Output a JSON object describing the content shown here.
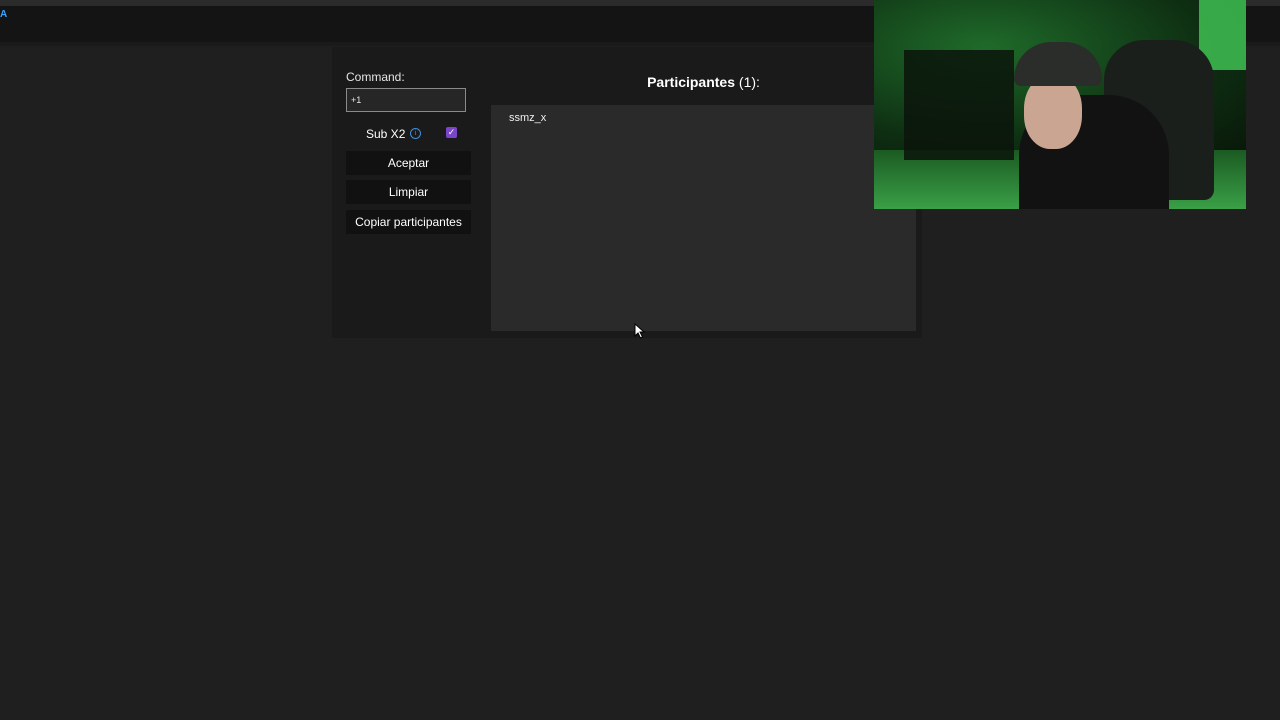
{
  "top_bar": {
    "corner_mark": "A"
  },
  "left_panel": {
    "command_label": "Command:",
    "command_value": "+1",
    "sub_label": "Sub X2",
    "sub_checked": true,
    "buttons": {
      "accept": "Aceptar",
      "clear": "Limpiar",
      "copy": "Copiar participantes"
    }
  },
  "participants": {
    "title": "Participantes",
    "count_text": "(1):",
    "items": [
      "ssmz_x"
    ]
  },
  "colors": {
    "background": "#1f1f1f",
    "panel": "#1a1a1a",
    "list_area": "#2a2a2a",
    "checkbox": "#7b45c9",
    "info": "#3b8fe0",
    "link_accent": "#3aa3ff"
  },
  "icons": {
    "info": "info-icon",
    "checkbox": "checkmark-icon",
    "cursor": "mouse-pointer-icon"
  }
}
